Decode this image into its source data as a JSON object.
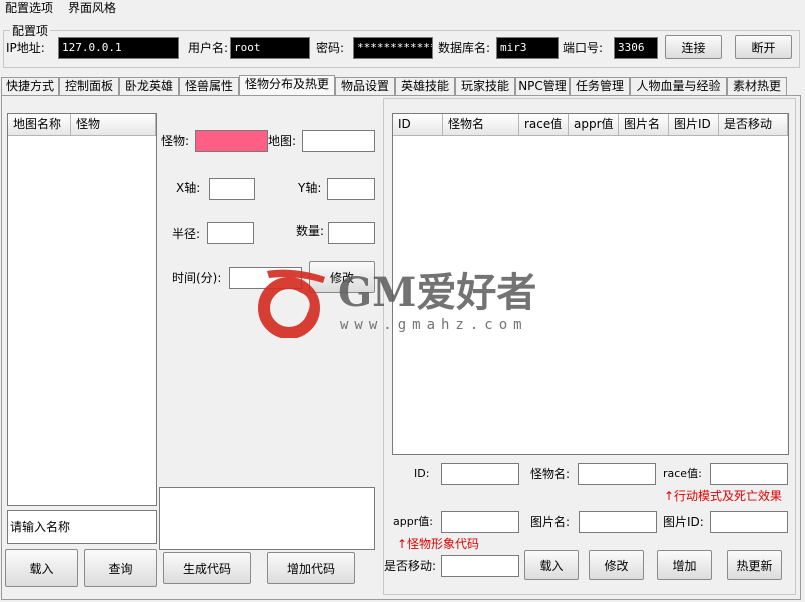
{
  "menu": {
    "items": [
      "配置选项",
      "界面风格"
    ]
  },
  "config": {
    "group_title": "配置项",
    "ip_label": "IP地址:",
    "ip_value": "127.0.0.1",
    "user_label": "用户名:",
    "user_value": "root",
    "pwd_label": "密码:",
    "pwd_value": "**************",
    "db_label": "数据库名:",
    "db_value": "mir3",
    "port_label": "端口号:",
    "port_value": "3306",
    "connect_label": "连接",
    "disconnect_label": "断开"
  },
  "tabs": [
    "快捷方式",
    "控制面板",
    "卧龙英雄",
    "怪兽属性",
    "怪物分布及热更",
    "物品设置",
    "英雄技能",
    "玩家技能",
    "NPC管理",
    "任务管理",
    "人物血量与经验",
    "素材热更"
  ],
  "active_tab": "怪物分布及热更",
  "left": {
    "columns": [
      "地图名称",
      "怪物"
    ],
    "search_value": "请输入名称",
    "load_label": "载入",
    "query_label": "查询"
  },
  "middle": {
    "monster_label": "怪物:",
    "map_label": "地图:",
    "x_label": "X轴:",
    "y_label": "Y轴:",
    "radius_label": "半径:",
    "count_label": "数量:",
    "time_label": "时间(分):",
    "modify_label": "修改",
    "gen_code_label": "生成代码",
    "add_code_label": "增加代码"
  },
  "right": {
    "columns": [
      "ID",
      "怪物名",
      "race值",
      "appr值",
      "图片名",
      "图片ID",
      "是否移动"
    ],
    "id_label": "ID:",
    "name_label": "怪物名:",
    "race_label": "race值:",
    "race_hint": "↑行动模式及死亡效果",
    "appr_label": "appr值:",
    "img_name_label": "图片名:",
    "img_id_label": "图片ID:",
    "appr_hint": "↑怪物形象代码",
    "move_label": "是否移动:",
    "load_label": "载入",
    "modify_label": "修改",
    "add_label": "增加",
    "hot_update_label": "热更新"
  },
  "watermark": {
    "brand": "GM爱好者",
    "url": "www.gmahz.com"
  },
  "colors": {
    "monster_field": "#ff5f85",
    "hint": "#e00000",
    "watermark_red": "#d42a1e"
  }
}
